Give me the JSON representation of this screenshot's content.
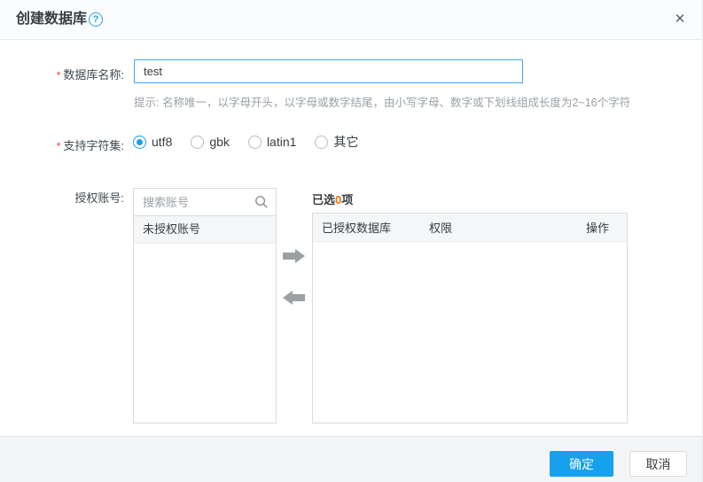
{
  "dialog": {
    "title": "创建数据库",
    "icons": {
      "help_glyph": "?",
      "close_glyph": "✕",
      "search": "magnifier-icon",
      "transfer_right": "right-block-arrow",
      "transfer_left": "left-block-arrow"
    }
  },
  "form": {
    "db_name": {
      "required_mark": "*",
      "label": "数据库名称:",
      "value": "test",
      "hint": "提示: 名称唯一，以字母开头，以字母或数字结尾，由小写字母、数字或下划线组成长度为2~16个字符"
    },
    "charset": {
      "required_mark": "*",
      "label": "支持字符集:",
      "selected": "utf8",
      "options": [
        {
          "label": "utf8",
          "selected": true
        },
        {
          "label": "gbk",
          "selected": false
        },
        {
          "label": "latin1",
          "selected": false
        },
        {
          "label": "其它",
          "selected": false
        }
      ]
    },
    "account": {
      "label": "授权账号:",
      "search_placeholder": "搜索账号",
      "unauthorized_list_header": "未授权账号",
      "unauthorized_items": [],
      "selected_prefix": "已选",
      "selected_count": "0",
      "selected_suffix": "项",
      "table_headers": [
        "已授权数据库",
        "权限",
        "操作"
      ],
      "table_rows": []
    }
  },
  "footer": {
    "ok_label": "确定",
    "cancel_label": "取消"
  },
  "colors": {
    "accent_blue": "#15a1ec",
    "input_focus_border": "#3ba4f0",
    "count_orange": "#ff6a00",
    "required_red": "#f04134",
    "arrow_gray": "#9da0a3",
    "footer_bg": "#f3f5f6"
  }
}
